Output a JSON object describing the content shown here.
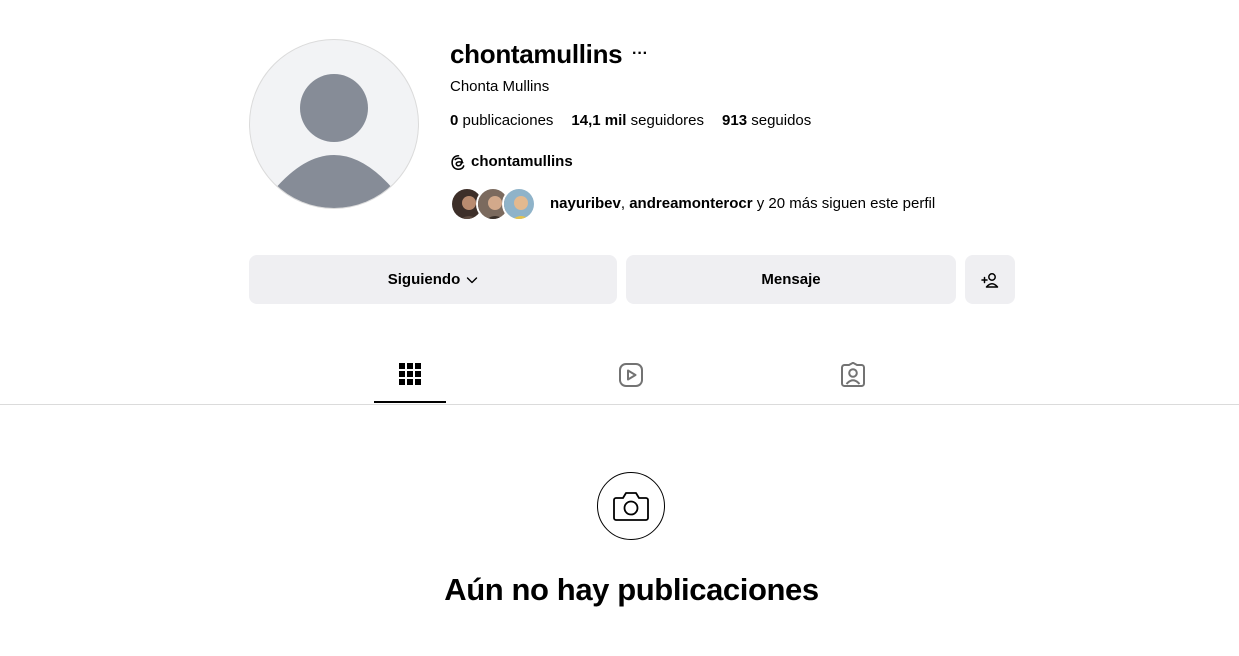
{
  "profile": {
    "username": "chontamullins",
    "more_label": "···",
    "full_name": "Chonta Mullins",
    "threads_handle": "chontamullins"
  },
  "stats": {
    "posts_count": "0",
    "posts_label": "publicaciones",
    "followers_count": "14,1 mil",
    "followers_label": "seguidores",
    "following_count": "913",
    "following_label": "seguidos"
  },
  "followed_by": {
    "user1": "nayuribev",
    "separator": ", ",
    "user2": "andreamonterocr",
    "suffix": " y 20 más siguen este perfil",
    "avatar_colors": [
      "#4a3a33",
      "#8a6f62",
      "#c9a96e"
    ]
  },
  "actions": {
    "following_label": "Siguiendo",
    "message_label": "Mensaje"
  },
  "tabs": [
    {
      "name": "posts",
      "icon": "grid-icon",
      "active": true
    },
    {
      "name": "reels",
      "icon": "reels-icon",
      "active": false
    },
    {
      "name": "tagged",
      "icon": "tagged-icon",
      "active": false
    }
  ],
  "empty_state": {
    "icon": "camera-icon",
    "title": "Aún no hay publicaciones"
  },
  "colors": {
    "button_bg": "#efeff2",
    "avatar_bg": "#f2f3f5",
    "avatar_silhouette": "#868c97",
    "divider": "#dbdbdb"
  }
}
